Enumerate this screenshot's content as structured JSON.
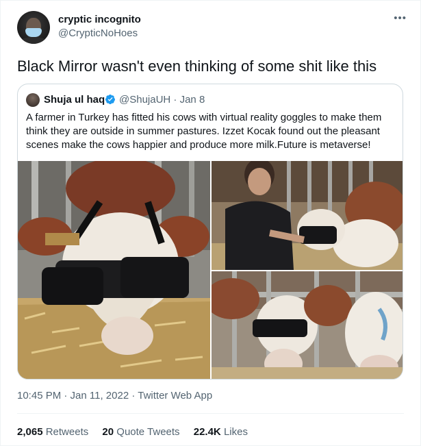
{
  "author": {
    "display_name": "cryptic incognito",
    "handle": "@CrypticNoHoes"
  },
  "tweet_text": "Black Mirror wasn't even thinking of some shit like this",
  "quote": {
    "display_name": "Shuja ul haq",
    "handle_date": "@ShujaUH · Jan 8",
    "text": "A farmer in Turkey has fitted his cows with virtual reality goggles to make them think they are outside in summer pastures. Izzet Kocak found out the pleasant scenes make the cows happier and produce more milk.Future is metaverse!",
    "photo_labels": [
      "cow with vr headset",
      "farmer with cow",
      "cows with vr headsets"
    ]
  },
  "meta": {
    "timestamp": "10:45 PM · Jan 11, 2022 · ",
    "app": "Twitter Web App"
  },
  "stats": {
    "retweets_count": "2,065",
    "retweets_label": "Retweets",
    "quotes_count": "20",
    "quotes_label": "Quote Tweets",
    "likes_count": "22.4K",
    "likes_label": "Likes"
  },
  "colors": {
    "verified": "#1d9bf0",
    "secondary_text": "#536471",
    "border": "#cfd9de"
  }
}
